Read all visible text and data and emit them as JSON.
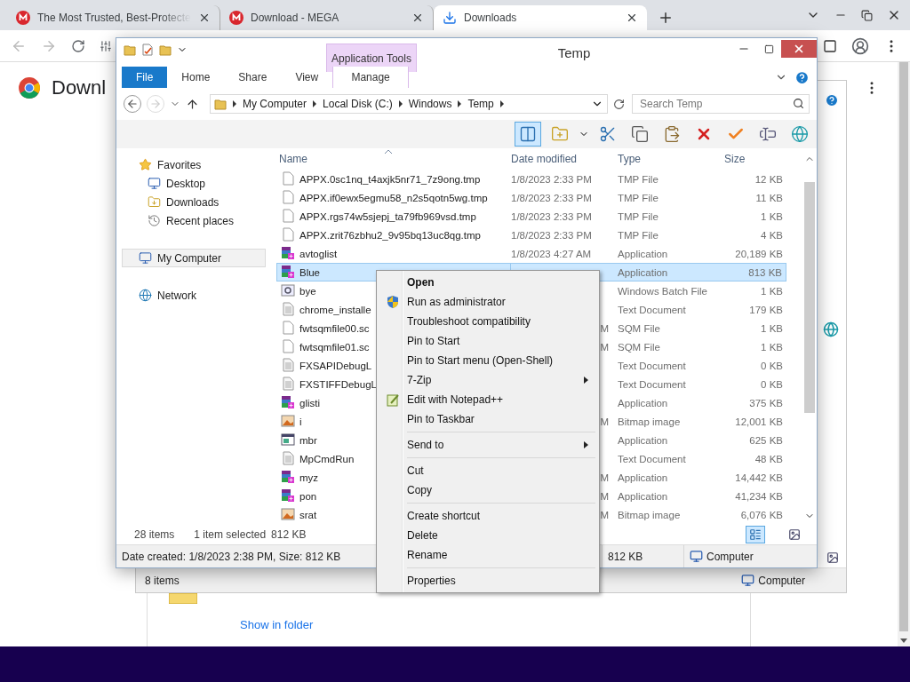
{
  "browser": {
    "tabs": [
      {
        "title": "The Most Trusted, Best-Protecte",
        "kind": "mega",
        "selected": false
      },
      {
        "title": "Download - MEGA",
        "kind": "mega",
        "selected": false
      },
      {
        "title": "Downloads",
        "kind": "download",
        "selected": true
      }
    ],
    "page": {
      "title": "Downl",
      "link": "Show in folder"
    }
  },
  "background_window": {
    "items": "8 items",
    "location": "Computer"
  },
  "explorer": {
    "title": "Temp",
    "contextual_group": "Application Tools",
    "ribbon_tabs": [
      {
        "label": "File",
        "kind": "file",
        "selected": false
      },
      {
        "label": "Home",
        "kind": "tab",
        "selected": false
      },
      {
        "label": "Share",
        "kind": "tab",
        "selected": false
      },
      {
        "label": "View",
        "kind": "tab",
        "selected": false
      },
      {
        "label": "Manage",
        "kind": "contextual",
        "selected": false
      }
    ],
    "address": [
      "My Computer",
      "Local Disk (C:)",
      "Windows",
      "Temp"
    ],
    "search": {
      "placeholder": "Search Temp"
    },
    "toolbar": [
      {
        "kind": "pane",
        "selected": true
      },
      {
        "kind": "new_folder",
        "selected": false
      },
      {
        "kind": "cut",
        "selected": false
      },
      {
        "kind": "copy",
        "selected": false
      },
      {
        "kind": "paste",
        "selected": false
      },
      {
        "kind": "delete",
        "selected": false
      },
      {
        "kind": "check",
        "selected": false
      },
      {
        "kind": "rename",
        "selected": false
      },
      {
        "kind": "globe",
        "selected": false
      }
    ],
    "nav": [
      {
        "label": "Favorites",
        "kind": "star",
        "selected": false,
        "children": [
          {
            "label": "Desktop",
            "kind": "desktop",
            "selected": false
          },
          {
            "label": "Downloads",
            "kind": "downloads",
            "selected": false
          },
          {
            "label": "Recent places",
            "kind": "recent",
            "selected": false
          }
        ]
      },
      {
        "label": "My Computer",
        "kind": "computer",
        "selected": true
      },
      {
        "label": "Network",
        "kind": "network",
        "selected": false
      }
    ],
    "columns": [
      "Name",
      "Date modified",
      "Type",
      "Size"
    ],
    "rows": [
      {
        "name": "APPX.0sc1nq_t4axjk5nr71_7z9ong.tmp",
        "date": "1/8/2023 2:33 PM",
        "date_cut": false,
        "type": "TMP File",
        "size": "12 KB",
        "kind": "blank",
        "selected": false
      },
      {
        "name": "APPX.if0ewx5egmu58_n2s5qotn5wg.tmp",
        "date": "1/8/2023 2:33 PM",
        "date_cut": false,
        "type": "TMP File",
        "size": "11 KB",
        "kind": "blank",
        "selected": false
      },
      {
        "name": "APPX.rgs74w5sjepj_ta79fb969vsd.tmp",
        "date": "1/8/2023 2:33 PM",
        "date_cut": false,
        "type": "TMP File",
        "size": "1 KB",
        "kind": "blank",
        "selected": false
      },
      {
        "name": "APPX.zrit76zbhu2_9v95bq13uc8qg.tmp",
        "date": "1/8/2023 2:33 PM",
        "date_cut": false,
        "type": "TMP File",
        "size": "4 KB",
        "kind": "blank",
        "selected": false
      },
      {
        "name": "avtoglist",
        "date": "1/8/2023 4:27 AM",
        "date_cut": false,
        "type": "Application",
        "size": "20,189 KB",
        "kind": "app",
        "selected": false
      },
      {
        "name": "Blue",
        "type": "Application",
        "size": "813 KB",
        "kind": "app",
        "selected": true
      },
      {
        "name": "bye",
        "type": "Windows Batch File",
        "size": "1 KB",
        "kind": "batch",
        "selected": false
      },
      {
        "name": "chrome_installe",
        "type": "Text Document",
        "size": "179 KB",
        "kind": "text",
        "selected": false
      },
      {
        "name": "fwtsqmfile00.sc",
        "date": "M",
        "date_cut": true,
        "type": "SQM File",
        "size": "1 KB",
        "kind": "blank",
        "selected": false
      },
      {
        "name": "fwtsqmfile01.sc",
        "date": "M",
        "date_cut": true,
        "type": "SQM File",
        "size": "1 KB",
        "kind": "blank",
        "selected": false
      },
      {
        "name": "FXSAPIDebugL",
        "type": "Text Document",
        "size": "0 KB",
        "kind": "text",
        "selected": false
      },
      {
        "name": "FXSTIFFDebugL",
        "type": "Text Document",
        "size": "0 KB",
        "kind": "text",
        "selected": false
      },
      {
        "name": "glisti",
        "type": "Application",
        "size": "375 KB",
        "kind": "app",
        "selected": false
      },
      {
        "name": "i",
        "date": "M",
        "date_cut": true,
        "type": "Bitmap image",
        "size": "12,001 KB",
        "kind": "image",
        "selected": false
      },
      {
        "name": "mbr",
        "type": "Application",
        "size": "625 KB",
        "kind": "window",
        "selected": false
      },
      {
        "name": "MpCmdRun",
        "type": "Text Document",
        "size": "48 KB",
        "kind": "text",
        "selected": false
      },
      {
        "name": "myz",
        "date": "M",
        "date_cut": true,
        "type": "Application",
        "size": "14,442 KB",
        "kind": "app",
        "selected": false
      },
      {
        "name": "pon",
        "date": "M",
        "date_cut": true,
        "type": "Application",
        "size": "41,234 KB",
        "kind": "app",
        "selected": false
      },
      {
        "name": "srat",
        "date": "M",
        "date_cut": true,
        "type": "Bitmap image",
        "size": "6,076 KB",
        "kind": "image",
        "selected": false
      }
    ],
    "status": {
      "items": "28 items",
      "selection": "1 item selected",
      "size": "812 KB"
    },
    "views": [
      {
        "kind": "details",
        "selected": true
      },
      {
        "kind": "tiles",
        "selected": false
      }
    ],
    "details": {
      "info": "Date created: 1/8/2023 2:38 PM, Size: 812 KB",
      "size": "812 KB",
      "location": "Computer"
    }
  },
  "context_menu": [
    {
      "label": "Open",
      "kind": "command",
      "default": true,
      "submenu": false
    },
    {
      "label": "Run as administrator",
      "kind": "shield",
      "default": false,
      "submenu": false
    },
    {
      "label": "Troubleshoot compatibility",
      "kind": "command",
      "default": false,
      "submenu": false
    },
    {
      "label": "Pin to Start",
      "kind": "command",
      "default": false,
      "submenu": false
    },
    {
      "label": "Pin to Start menu (Open-Shell)",
      "kind": "command",
      "default": false,
      "submenu": false
    },
    {
      "label": "7-Zip",
      "kind": "command",
      "default": false,
      "submenu": true
    },
    {
      "label": "Edit with Notepad++",
      "kind": "notepad",
      "default": false,
      "submenu": false
    },
    {
      "label": "Pin to Taskbar",
      "kind": "command",
      "default": false,
      "submenu": false
    },
    {
      "kind": "separator"
    },
    {
      "label": "Send to",
      "kind": "command",
      "default": false,
      "submenu": true
    },
    {
      "kind": "separator"
    },
    {
      "label": "Cut",
      "kind": "command",
      "default": false,
      "submenu": false
    },
    {
      "label": "Copy",
      "kind": "command",
      "default": false,
      "submenu": false
    },
    {
      "kind": "separator"
    },
    {
      "label": "Create shortcut",
      "kind": "command",
      "default": false,
      "submenu": false
    },
    {
      "label": "Delete",
      "kind": "command",
      "default": false,
      "submenu": false
    },
    {
      "label": "Rename",
      "kind": "command",
      "default": false,
      "submenu": false
    },
    {
      "kind": "separator"
    },
    {
      "label": "Properties",
      "kind": "command",
      "default": false,
      "submenu": false
    }
  ]
}
